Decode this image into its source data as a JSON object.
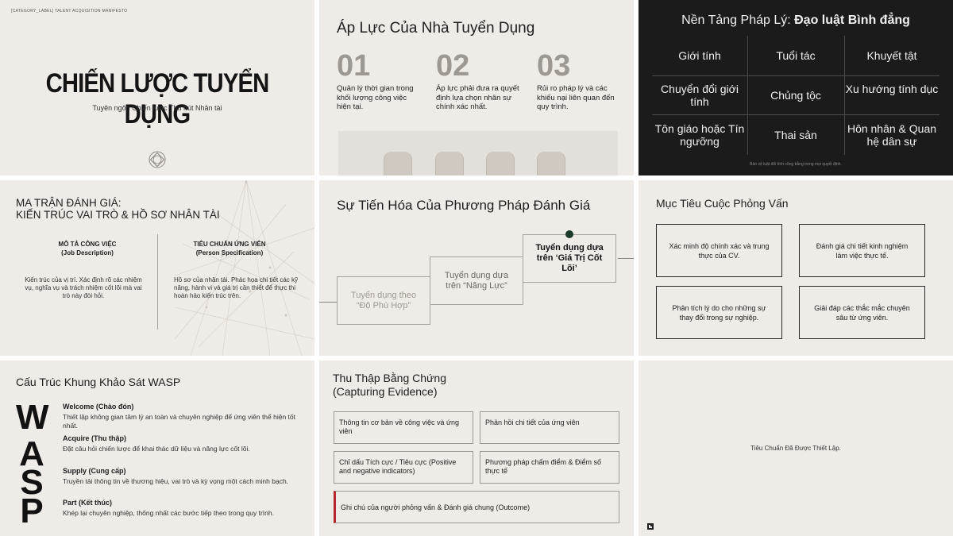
{
  "slide1": {
    "top_label": "[CATEGORY_LABEL] TALENT ACQUISITION MANIFESTO",
    "title": "CHIẾN LƯỢC TUYỂN DỤNG",
    "subtitle": "Tuyên ngôn Chiến lược Thu hút Nhân tài",
    "logo_icon": "interlocked-circles-icon"
  },
  "slide2": {
    "title": "Áp Lực Của Nhà Tuyển Dụng",
    "items": [
      {
        "num": "01",
        "text": "Quản lý thời gian trong khối lượng công việc hiện tại."
      },
      {
        "num": "02",
        "text": "Áp lực phải đưa ra quyết định lựa chọn nhân sự chính xác nhất."
      },
      {
        "num": "03",
        "text": "Rủi ro pháp lý và các khiếu nại liên quan đến quy trình."
      }
    ]
  },
  "slide3": {
    "title_prefix": "Nền Tảng Pháp Lý: ",
    "title_bold": "Đạo luật Bình đẳng",
    "cells": [
      "Giới tính",
      "Tuổi tác",
      "Khuyết tật",
      "Chuyển đổi giới tính",
      "Chủng tộc",
      "Xu hướng tính dục",
      "Tôn giáo hoặc Tín ngưỡng",
      "Thai sản",
      "Hôn nhân & Quan hệ dân sự"
    ],
    "footnote": "Bảo vệ luật đối tính công bằng trong mọi quyết định."
  },
  "slide4": {
    "title_line1": "MA TRẬN ĐÁNH GIÁ:",
    "title_line2": "KIẾN TRÚC VAI TRÒ & HỒ SƠ NHÂN TÀI",
    "col1_heading": "MÔ TẢ CÔNG VIỆC",
    "col1_sub": "(Job Description)",
    "col1_text": "Kiến trúc của vị trí. Xác định rõ các nhiệm vụ, nghĩa vụ và trách nhiệm cốt lõi mà vai trò này đòi hỏi.",
    "col2_heading": "TIÊU CHUẨN ỨNG VIÊN",
    "col2_sub": "(Person Specification)",
    "col2_text": "Hồ sơ của nhân tài. Phác họa chi tiết các kỹ năng, hành vi và giá trị cần thiết để thực thi hoàn hảo kiến trúc trên."
  },
  "slide5": {
    "title": "Sự Tiến Hóa Của Phương Pháp Đánh Giá",
    "steps": [
      "Tuyển dụng theo “Độ Phù Hợp”",
      "Tuyển dụng dựa trên “Năng Lực”",
      "Tuyển dụng dựa trên ‘Giá Trị Cốt Lõi’"
    ]
  },
  "slide6": {
    "title": "Mục Tiêu Cuộc Phỏng Vấn",
    "objectives": [
      "Xác minh độ chính xác và trung thực của CV.",
      "Đánh giá chi tiết kinh nghiệm làm việc thực tế.",
      "Phân tích lý do cho những sự thay đổi trong sự nghiệp.",
      "Giải đáp các thắc mắc chuyên sâu từ ứng viên."
    ]
  },
  "slide7": {
    "title": "Cấu Trúc Khung Khảo Sát WASP",
    "letters": [
      "W",
      "A",
      "S",
      "P"
    ],
    "items": [
      {
        "heading": "Welcome (Chào đón)",
        "text": "Thiết lập không gian tâm lý an toàn và chuyên nghiệp để ứng viên thể hiện tốt nhất."
      },
      {
        "heading": "Acquire (Thu thập)",
        "text": "Đặt câu hỏi chiến lược để khai thác dữ liệu và năng lực cốt lõi."
      },
      {
        "heading": "Supply (Cung cấp)",
        "text": "Truyền tải thông tin về thương hiệu, vai trò và kỳ vọng một cách minh bạch."
      },
      {
        "heading": "Part (Kết thúc)",
        "text": "Khép lại chuyên nghiệp, thống nhất các bước tiếp theo trong quy trình."
      }
    ]
  },
  "slide8": {
    "title_line1": "Thu Thập Bằng Chứng",
    "title_line2": "(Capturing Evidence)",
    "boxes": [
      "Thông tin cơ bản về công việc và ứng viên",
      "Phản hồi chi tiết của ứng viên",
      "Chỉ dấu Tích cực / Tiêu cực (Positive and negative indicators)",
      "Phương pháp chấm điểm & Điểm số thực tế",
      "Ghi chú của người phỏng vấn & Đánh giá chung (Outcome)"
    ],
    "accent_color": "#b3262c"
  },
  "slide9": {
    "text": "Tiêu Chuẩn Đã Được Thiết Lập.",
    "corner_icon": "corner-logo-icon"
  }
}
